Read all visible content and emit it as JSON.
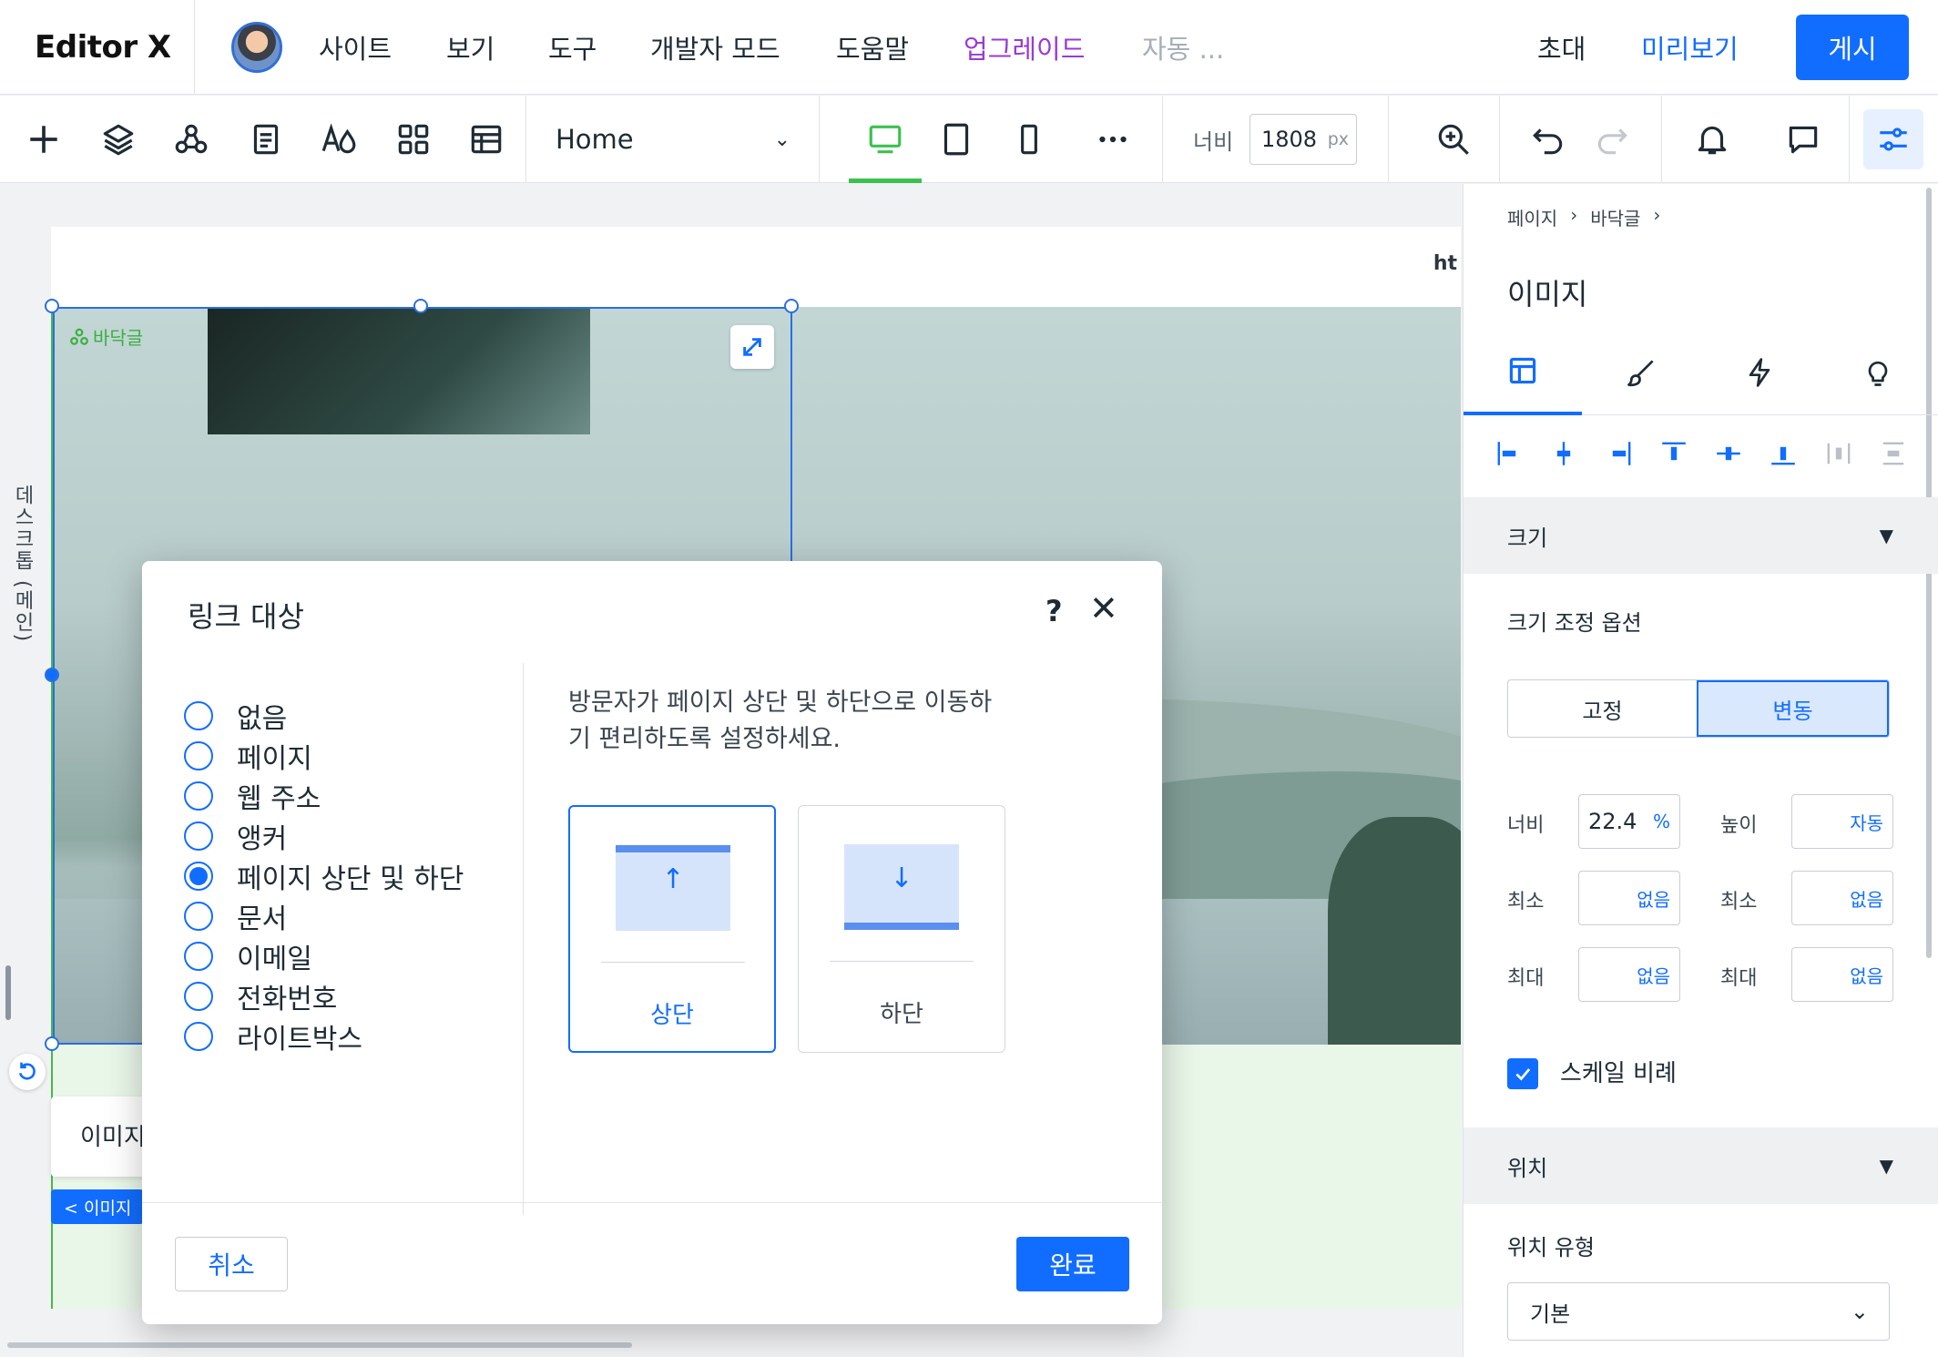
{
  "app": {
    "logo": "Editor X"
  },
  "topbar": {
    "menu": [
      "사이트",
      "보기",
      "도구",
      "개발자 모드",
      "도움말"
    ],
    "upgrade": "업그레이드",
    "auto": "자동 ...",
    "invite": "초대",
    "preview": "미리보기",
    "publish": "게시"
  },
  "toolbar": {
    "page_name": "Home",
    "width_label": "너비",
    "width_value": "1808",
    "width_unit": "px"
  },
  "canvas": {
    "left_label": "데스크톱 (메인)",
    "header_text": "ht",
    "section_tag": "바닥글",
    "float_label": "이미지 변경",
    "breadcrumb_tag": "< 이미지"
  },
  "dialog": {
    "title": "링크 대상",
    "help": "?",
    "close": "✕",
    "options": [
      "없음",
      "페이지",
      "웹 주소",
      "앵커",
      "페이지 상단 및 하단",
      "문서",
      "이메일",
      "전화번호",
      "라이트박스"
    ],
    "selected_option": "페이지 상단 및 하단",
    "description": "방문자가 페이지 상단 및 하단으로 이동하기 편리하도록 설정하세요.",
    "cards": [
      {
        "label": "상단",
        "arrow": "↑",
        "selected": true
      },
      {
        "label": "하단",
        "arrow": "↓",
        "selected": false
      }
    ],
    "cancel": "취소",
    "done": "완료"
  },
  "right_panel": {
    "breadcrumb": [
      "페이지",
      "바닥글"
    ],
    "title": "이미지",
    "size_section": "크기",
    "resize_options_label": "크기 조정 옵션",
    "segments": [
      "고정",
      "변동"
    ],
    "active_segment": "변동",
    "width_label": "너비",
    "width_value": "22.4",
    "width_unit": "%",
    "height_label": "높이",
    "height_value": "자동",
    "min_label": "최소",
    "max_label": "최대",
    "none_value": "없음",
    "scale_label": "스케일 비례",
    "scale_checked": true,
    "position_section": "위치",
    "position_type_label": "위치 유형",
    "position_type_value": "기본"
  },
  "colors": {
    "accent": "#116dff",
    "upgrade": "#9a3ad3",
    "section_green": "#3aaf3f"
  }
}
